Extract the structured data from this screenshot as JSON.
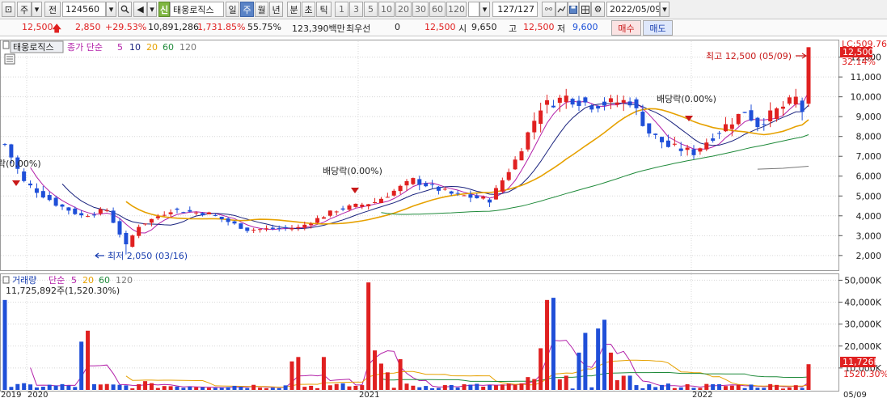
{
  "toolbar": {
    "market": "주",
    "prev_label": "전",
    "code": "124560",
    "new_tag": "신",
    "stock_name": "태웅로직스",
    "periods": [
      "일",
      "주",
      "월",
      "년",
      "분",
      "초",
      "틱"
    ],
    "selected_period": "주",
    "minute_options": [
      "1",
      "3",
      "5",
      "10",
      "20",
      "30",
      "60",
      "120"
    ],
    "count": "127/127",
    "date": "2022/05/09"
  },
  "quote": {
    "price": "12,500",
    "change": "2,850",
    "change_pct": "+29.53%",
    "volume": "10,891,286",
    "volume_pct": "1,731.85%",
    "ratio": "55.75%",
    "amount": "123,390백만",
    "priority_label": "최우선",
    "priority_value": "0",
    "priority_price": "12,500",
    "open_label": "시",
    "open": "9,650",
    "high_label": "고",
    "high": "12,500",
    "low_label": "저",
    "low": "9,600",
    "buy_label": "매수",
    "sell_label": "매도"
  },
  "price_panel": {
    "stock_tab": "태웅로직스",
    "ma_title": "종가 단순",
    "ma_periods": [
      "5",
      "10",
      "20",
      "60",
      "120"
    ],
    "lc_label": "LC:509.76",
    "current_tag": "12,500",
    "pct_tag": "32.14%",
    "high_annotation": "최고 12,500 (05/09)",
    "low_annotation": "최저 2,050 (03/16)",
    "dividend_annotations": [
      "락(0.00%)",
      "배당락(0.00%)",
      "배당락(0.00%)"
    ]
  },
  "volume_panel": {
    "title": "거래량",
    "ma_title": "단순",
    "ma_periods": [
      "5",
      "20",
      "60",
      "120"
    ],
    "info": "11,725,892주(1,520.30%)",
    "current_tag": "11,726K",
    "pct_tag": "1520.30%"
  },
  "colors": {
    "up": "#e02020",
    "down": "#1f4fd8",
    "ma5": "#b21fa8",
    "ma10": "#1a237e",
    "ma20": "#e6a100",
    "ma60": "#1f8a3a",
    "ma120": "#777777",
    "grid": "#d8d8d8"
  },
  "chart_data": {
    "type": "candlestick",
    "interval": "weekly",
    "x_range": [
      "2019-12",
      "2022-05-09"
    ],
    "x_tick_labels": [
      "2019",
      "2020",
      "2021",
      "2022",
      "05/09"
    ],
    "price_axis_ticks": [
      2000,
      3000,
      4000,
      5000,
      6000,
      7000,
      8000,
      9000,
      10000,
      11000,
      12000
    ],
    "price_axis_labels": [
      "2,000",
      "3,000",
      "4,000",
      "5,000",
      "6,000",
      "7,000",
      "8,000",
      "9,000",
      "10,000",
      "11,000",
      "12,000"
    ],
    "price_ylim": [
      1300,
      12800
    ],
    "volume_axis_ticks": [
      10000,
      20000,
      30000,
      40000,
      50000
    ],
    "volume_axis_labels": [
      "10,000K",
      "20,000K",
      "30,000K",
      "40,000K",
      "50,000K"
    ],
    "volume_ylim": [
      0,
      52000
    ],
    "highest": 12500,
    "lowest": 2050,
    "last_close": 12500,
    "last_volume_k": 11726
  }
}
